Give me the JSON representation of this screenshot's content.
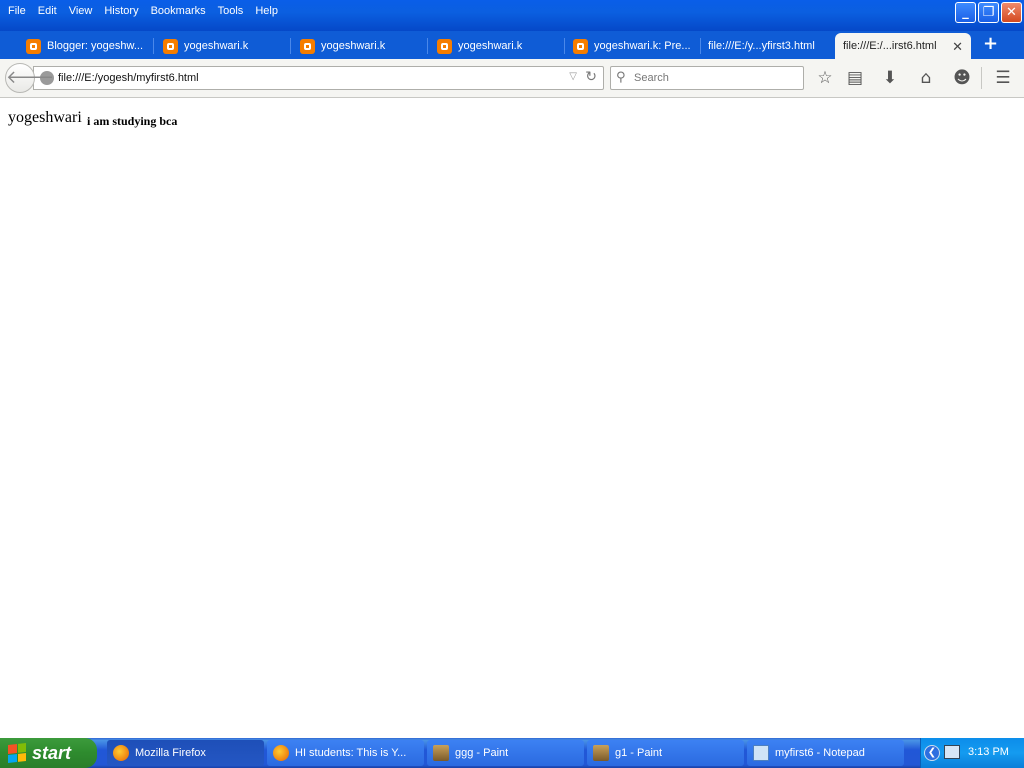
{
  "menu": [
    "File",
    "Edit",
    "View",
    "History",
    "Bookmarks",
    "Tools",
    "Help"
  ],
  "window_controls": {
    "minimize": "_",
    "restore": "❐",
    "close": "✕"
  },
  "tabs": [
    {
      "label": "Blogger: yogeshw...",
      "icon": "blogger-icon"
    },
    {
      "label": "yogeshwari.k",
      "icon": "blogger-icon"
    },
    {
      "label": "yogeshwari.k",
      "icon": "blogger-icon"
    },
    {
      "label": "yogeshwari.k",
      "icon": "blogger-icon"
    },
    {
      "label": "yogeshwari.k: Pre...",
      "icon": "blogger-icon"
    },
    {
      "label": "file:///E:/y...yfirst3.html",
      "icon": ""
    },
    {
      "label": "file:///E:/...irst6.html",
      "icon": "",
      "active": true
    }
  ],
  "newtab_label": "+",
  "url": "file:///E:/yogesh/myfirst6.html",
  "search_placeholder": "Search",
  "content": {
    "heading": "yogeshwari",
    "subtext": "i am studying bca"
  },
  "taskbar": {
    "start_label": "start",
    "tasks": [
      {
        "label": "Mozilla Firefox",
        "icon": "firefox-icon",
        "active": true
      },
      {
        "label": "HI students: This is Y...",
        "icon": "firefox-icon"
      },
      {
        "label": "ggg - Paint",
        "icon": "paint-icon"
      },
      {
        "label": "g1 - Paint",
        "icon": "paint-icon"
      },
      {
        "label": "myfirst6 - Notepad",
        "icon": "notepad-icon"
      }
    ],
    "clock": "3:13 PM"
  }
}
